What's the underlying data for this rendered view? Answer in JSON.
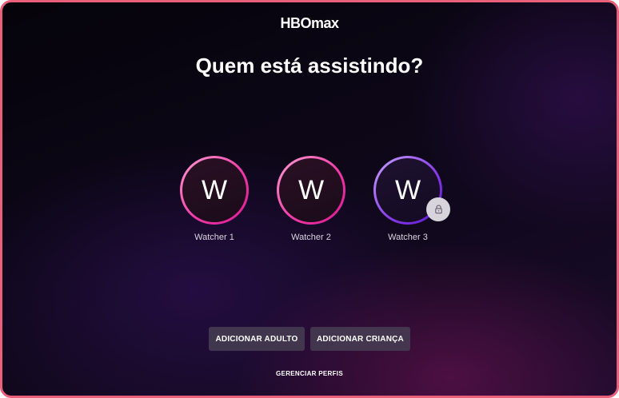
{
  "brand": {
    "hbo": "HBO",
    "max": "max"
  },
  "heading": "Quem está assistindo?",
  "profiles": [
    {
      "initial": "W",
      "name": "Watcher 1",
      "locked": false
    },
    {
      "initial": "W",
      "name": "Watcher 2",
      "locked": false
    },
    {
      "initial": "W",
      "name": "Watcher 3",
      "locked": true
    }
  ],
  "actions": {
    "add_adult": "ADICIONAR ADULTO",
    "add_child": "ADICIONAR CRIANÇA",
    "manage_profiles": "GERENCIAR PERFIS"
  },
  "icons": {
    "lock": "lock-icon"
  },
  "colors": {
    "frame_border": "#e8607a",
    "profile_ring_pink": "#f03aa8",
    "profile_ring_purple": "#8a3ee8",
    "button_bg": "#463e52"
  }
}
